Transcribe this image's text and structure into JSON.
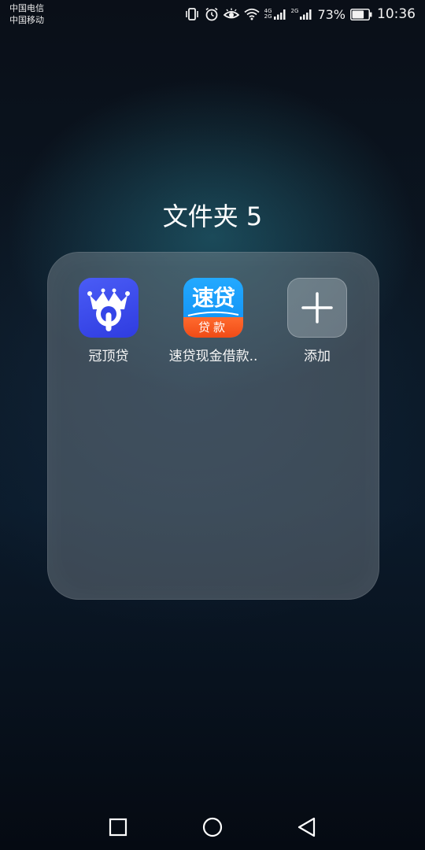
{
  "status_bar": {
    "carrier_1": "中国电信",
    "carrier_2": "中国移动",
    "sim1_network": "4G",
    "sim1_network_b": "2G",
    "sim2_network": "2G",
    "battery_percent": "73%",
    "battery_level": 0.73,
    "time": "10:36",
    "icons": [
      "vibrate-icon",
      "alarm-icon",
      "eye-comfort-icon",
      "wifi-icon",
      "signal-icon",
      "signal-icon",
      "battery-icon"
    ]
  },
  "folder": {
    "title": "文件夹 5",
    "apps": [
      {
        "label": "冠顶贷",
        "icon": "crown-lock-app-icon"
      },
      {
        "label": "速贷现金借款..",
        "icon": "sudai-app-icon",
        "icon_text_top": "速贷",
        "icon_text_bottom": "贷款"
      },
      {
        "label": "添加",
        "icon": "plus-icon"
      }
    ]
  },
  "nav_bar": {
    "buttons": [
      "recent-apps-button",
      "home-button",
      "back-button"
    ]
  }
}
